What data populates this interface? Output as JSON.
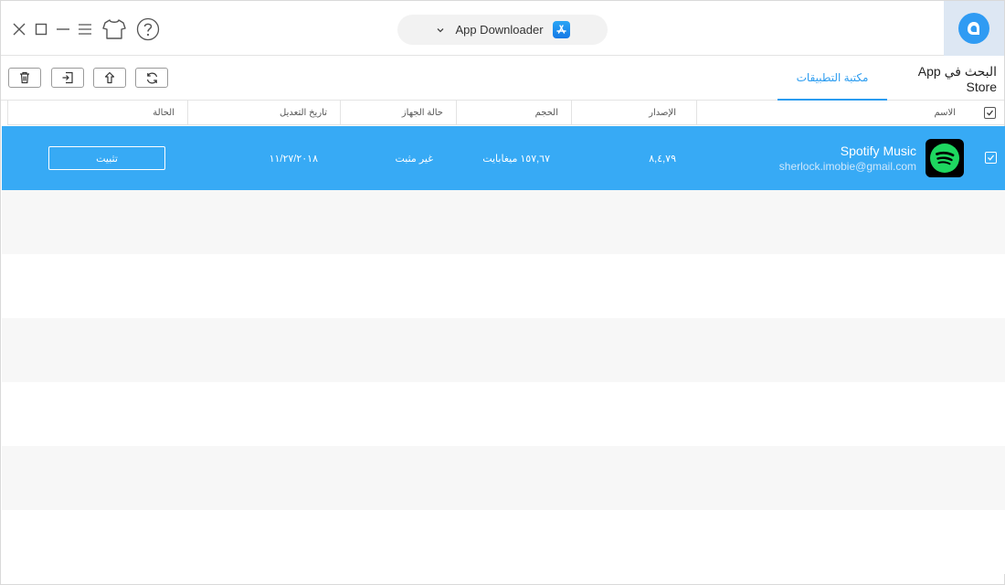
{
  "window": {
    "center_title": "App Downloader",
    "icons": [
      "close-icon",
      "maximize-icon",
      "minimize-icon",
      "menu-icon",
      "skin-icon",
      "help-icon",
      "chevron-down-icon",
      "app-store-icon",
      "anytrans-logo-icon"
    ]
  },
  "toolbar": {
    "buttons": [
      "delete-icon",
      "import-icon",
      "export-icon",
      "refresh-icon"
    ]
  },
  "tabs": {
    "search": "البحث في App Store",
    "library": "مكتبة التطبيقات"
  },
  "columns": {
    "name": "الاسم",
    "version": "الإصدار",
    "size": "الحجم",
    "device_status": "حالة الجهاز",
    "modified_date": "تاريخ التعديل",
    "status": "الحالة"
  },
  "apps": [
    {
      "name": "Spotify Music",
      "account": "sherlock.imobie@gmail.com",
      "version": "٨,٤,٧٩",
      "size": "١٥٧,٦٧ ميغابايت",
      "device_status": "غير مثبت",
      "modified_date": "١١/٢٧/٢٠١٨",
      "action": "تثبيت",
      "selected": true
    }
  ],
  "colors": {
    "accent": "#2b9cf0",
    "selected_row": "#37aaf5",
    "stripe": "#f7f7f7",
    "spotify_green": "#1ed760"
  }
}
